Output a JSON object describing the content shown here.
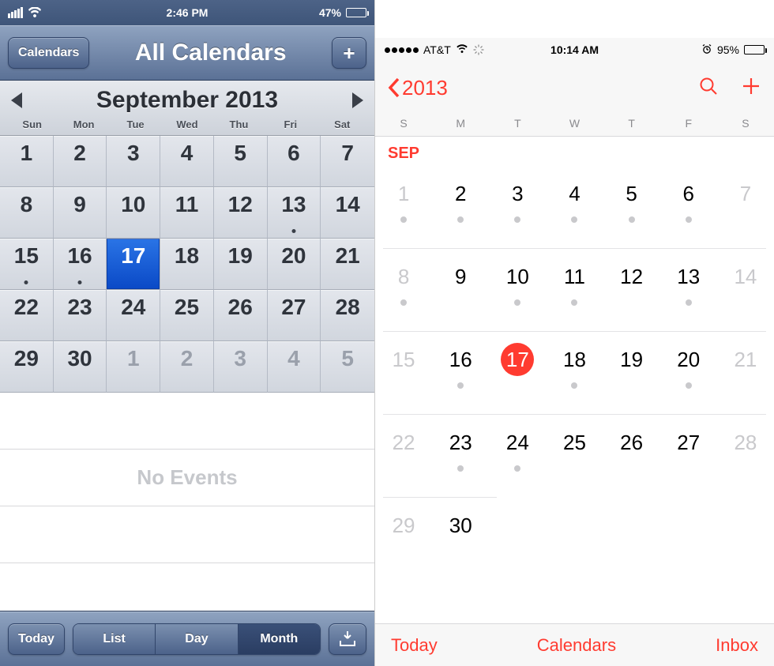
{
  "ios6": {
    "status": {
      "time": "2:46 PM",
      "battery": "47%"
    },
    "nav": {
      "calendars": "Calendars",
      "title": "All Calendars",
      "plus": "+"
    },
    "month": "September 2013",
    "dow": [
      "Sun",
      "Mon",
      "Tue",
      "Wed",
      "Thu",
      "Fri",
      "Sat"
    ],
    "days": [
      {
        "n": "1"
      },
      {
        "n": "2"
      },
      {
        "n": "3"
      },
      {
        "n": "4"
      },
      {
        "n": "5"
      },
      {
        "n": "6"
      },
      {
        "n": "7"
      },
      {
        "n": "8"
      },
      {
        "n": "9"
      },
      {
        "n": "10"
      },
      {
        "n": "11"
      },
      {
        "n": "12"
      },
      {
        "n": "13",
        "dot": true
      },
      {
        "n": "14"
      },
      {
        "n": "15",
        "dot": true
      },
      {
        "n": "16",
        "dot": true
      },
      {
        "n": "17",
        "sel": true
      },
      {
        "n": "18"
      },
      {
        "n": "19"
      },
      {
        "n": "20"
      },
      {
        "n": "21"
      },
      {
        "n": "22"
      },
      {
        "n": "23"
      },
      {
        "n": "24"
      },
      {
        "n": "25"
      },
      {
        "n": "26"
      },
      {
        "n": "27"
      },
      {
        "n": "28"
      },
      {
        "n": "29"
      },
      {
        "n": "30"
      },
      {
        "n": "1",
        "dim": true
      },
      {
        "n": "2",
        "dim": true
      },
      {
        "n": "3",
        "dim": true
      },
      {
        "n": "4",
        "dim": true
      },
      {
        "n": "5",
        "dim": true
      }
    ],
    "no_events": "No Events",
    "toolbar": {
      "today": "Today",
      "seg": [
        "List",
        "Day",
        "Month"
      ],
      "active": 2
    }
  },
  "ios7": {
    "status": {
      "carrier": "AT&T",
      "time": "10:14 AM",
      "battery": "95%"
    },
    "nav": {
      "back": "2013"
    },
    "dow": [
      "S",
      "M",
      "T",
      "W",
      "T",
      "F",
      "S"
    ],
    "month": "SEP",
    "weeks": [
      [
        {
          "n": "1",
          "w": true,
          "d": true
        },
        {
          "n": "2",
          "d": true
        },
        {
          "n": "3",
          "d": true
        },
        {
          "n": "4",
          "d": true
        },
        {
          "n": "5",
          "d": true
        },
        {
          "n": "6",
          "d": true
        },
        {
          "n": "7",
          "w": true
        }
      ],
      [
        {
          "n": "8",
          "w": true,
          "d": true
        },
        {
          "n": "9"
        },
        {
          "n": "10",
          "d": true
        },
        {
          "n": "11",
          "d": true
        },
        {
          "n": "12"
        },
        {
          "n": "13",
          "d": true
        },
        {
          "n": "14",
          "w": true
        }
      ],
      [
        {
          "n": "15",
          "w": true
        },
        {
          "n": "16",
          "d": true
        },
        {
          "n": "17",
          "sel": true
        },
        {
          "n": "18",
          "d": true
        },
        {
          "n": "19"
        },
        {
          "n": "20",
          "d": true
        },
        {
          "n": "21",
          "w": true
        }
      ],
      [
        {
          "n": "22",
          "w": true
        },
        {
          "n": "23",
          "d": true
        },
        {
          "n": "24",
          "d": true
        },
        {
          "n": "25"
        },
        {
          "n": "26"
        },
        {
          "n": "27"
        },
        {
          "n": "28",
          "w": true
        }
      ],
      [
        {
          "n": "29",
          "w": true
        },
        {
          "n": "30"
        }
      ]
    ],
    "toolbar": {
      "today": "Today",
      "calendars": "Calendars",
      "inbox": "Inbox"
    }
  }
}
